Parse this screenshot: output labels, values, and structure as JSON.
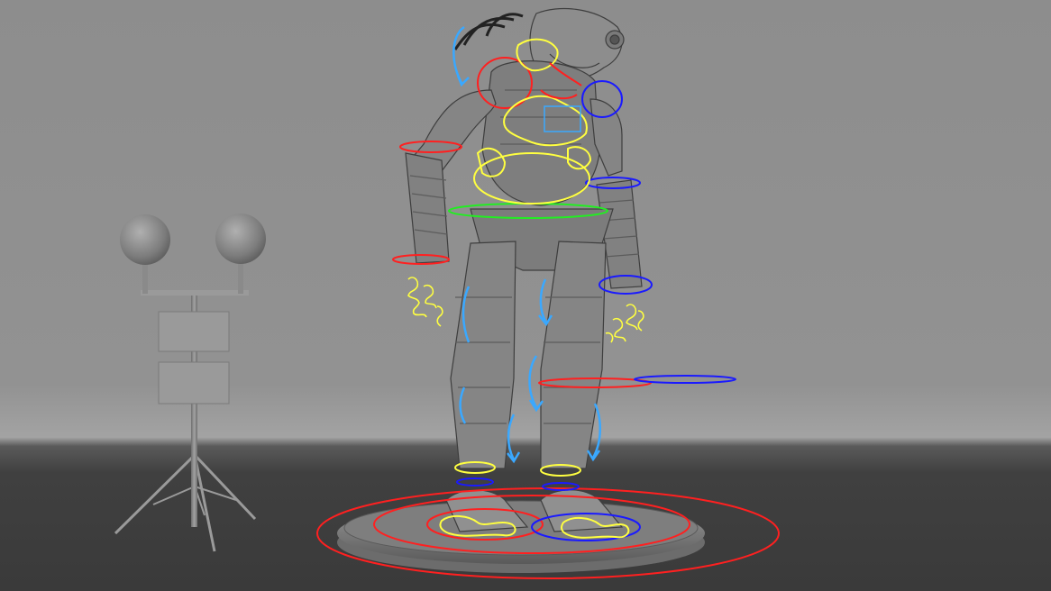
{
  "viewport": {
    "kind": "3d-viewport",
    "background_color": "#8f8f8f",
    "floor_color": "#3c3c3c",
    "horizon_glow_color": "#a6a6a6"
  },
  "scene": {
    "objects": [
      {
        "name": "robot-model",
        "color": "#8a8a8a"
      },
      {
        "name": "turntable-base",
        "color": "#8c8c8c"
      },
      {
        "name": "reference-light-stand",
        "color": "#8c8c8c"
      },
      {
        "name": "chrome-reference-sphere",
        "color": "#8a8a8a"
      },
      {
        "name": "grey-reference-sphere",
        "color": "#8a8a8a"
      }
    ],
    "rig_control_colors": {
      "fk_controls": "#ffff40",
      "left_side_controls": "#ff2020",
      "right_side_controls": "#1a1aff",
      "center_control": "#22ee22",
      "rotation_arrows": "#3aa8ff"
    }
  }
}
